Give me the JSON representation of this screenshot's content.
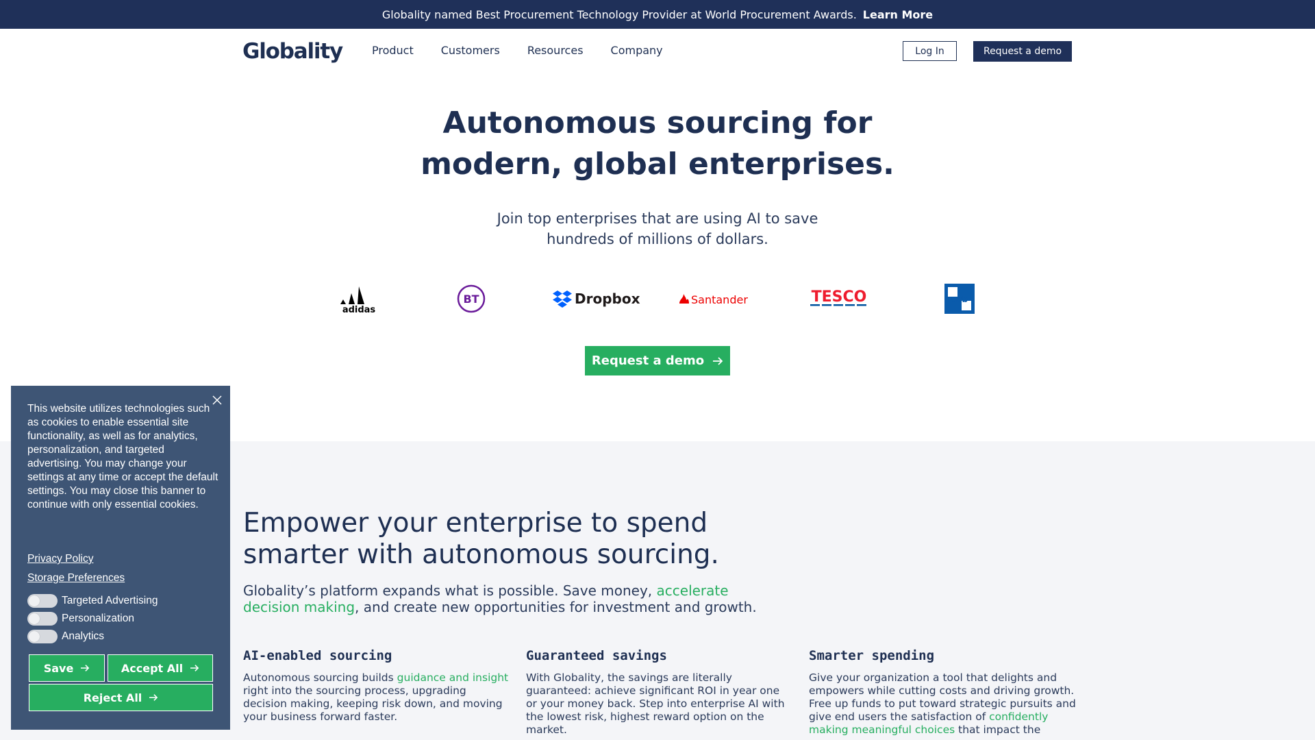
{
  "announcement": {
    "text": "Globality named Best Procurement Technology Provider at World Procurement Awards.",
    "link": "Learn More"
  },
  "nav": {
    "logo": "Globality",
    "items": [
      "Product",
      "Customers",
      "Resources",
      "Company"
    ],
    "login": "Log In",
    "demo": "Request a demo"
  },
  "hero": {
    "title_line1": "Autonomous sourcing for",
    "title_line2": "modern, global enterprises.",
    "sub_line1": "Join top enterprises that are using AI to save",
    "sub_line2": "hundreds of millions of dollars.",
    "cta": "Request a demo"
  },
  "logos": {
    "adidas": "adidas",
    "bt": "BT",
    "dropbox": "Dropbox",
    "santander": "Santander",
    "tesco": "TESCO",
    "ucb": "ucb"
  },
  "section2": {
    "title": "Empower your enterprise to spend smarter with autonomous sourcing.",
    "text_pre": "Globality’s platform expands what is possible. Save money, ",
    "text_link": "accelerate decision making",
    "text_post": ", and create new opportunities for investment and growth."
  },
  "columns": [
    {
      "title": "AI-enabled sourcing",
      "pre": "Autonomous sourcing builds ",
      "link": "guidance and insight",
      "post": " right into the sourcing process, upgrading decision making, keeping risk down, and moving your business forward faster."
    },
    {
      "title": "Guaranteed savings",
      "pre": "With Globality, the savings are literally guaranteed: achieve significant ROI in year one or your money back. Step into enterprise AI with the lowest risk, highest reward option on the market.",
      "link": "",
      "post": ""
    },
    {
      "title": "Smarter spending",
      "pre": "Give your organization a tool that delights and empowers while cutting costs and driving growth. Free up funds to put toward strategic pursuits and give end users the satisfaction of ",
      "link": "confidently making meaningful choices",
      "post": " that impact the"
    }
  ],
  "cookie": {
    "text": "This website utilizes technologies such as cookies to enable essential site functionality, as well as for analytics, personalization, and targeted advertising. You may change your settings at any time or accept the default settings. You may close this banner to continue with only essential cookies.",
    "privacy": "Privacy Policy",
    "storage": "Storage Preferences",
    "toggles": [
      "Targeted Advertising",
      "Personalization",
      "Analytics"
    ],
    "save": "Save",
    "accept": "Accept All",
    "reject": "Reject All"
  },
  "colors": {
    "navy": "#1f3059",
    "green": "#27ae60",
    "cookie_bg": "#3e5575",
    "section_bg": "#f4f5f8"
  }
}
